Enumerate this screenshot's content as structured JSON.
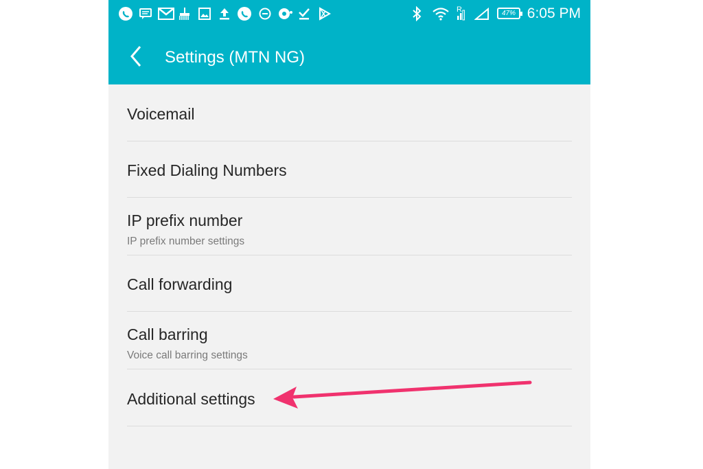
{
  "status_bar": {
    "time": "6:05 PM",
    "battery_percent": "47%",
    "network_indicator": "R",
    "left_icons": [
      "whatsapp-icon",
      "message-icon",
      "gmail-icon",
      "broom-icon",
      "image-icon",
      "upload-icon",
      "whatsapp-icon",
      "minus-circle-icon",
      "media-icon",
      "download-icon",
      "play-store-icon"
    ],
    "right_icons": [
      "bluetooth-icon",
      "wifi-icon",
      "signal-icon",
      "signal-empty-icon",
      "battery-icon"
    ]
  },
  "toolbar": {
    "back_icon": "chevron-left-icon",
    "title": "Settings (MTN NG)"
  },
  "settings": [
    {
      "title": "Voicemail",
      "subtitle": ""
    },
    {
      "title": "Fixed Dialing Numbers",
      "subtitle": ""
    },
    {
      "title": "IP prefix number",
      "subtitle": "IP prefix number settings"
    },
    {
      "title": "Call forwarding",
      "subtitle": ""
    },
    {
      "title": "Call barring",
      "subtitle": "Voice call barring settings"
    },
    {
      "title": "Additional settings",
      "subtitle": ""
    }
  ],
  "annotation": {
    "arrow_color": "#f0326e",
    "target": "Additional settings"
  },
  "colors": {
    "appbar": "#00b3c8",
    "background": "#f2f2f2"
  }
}
